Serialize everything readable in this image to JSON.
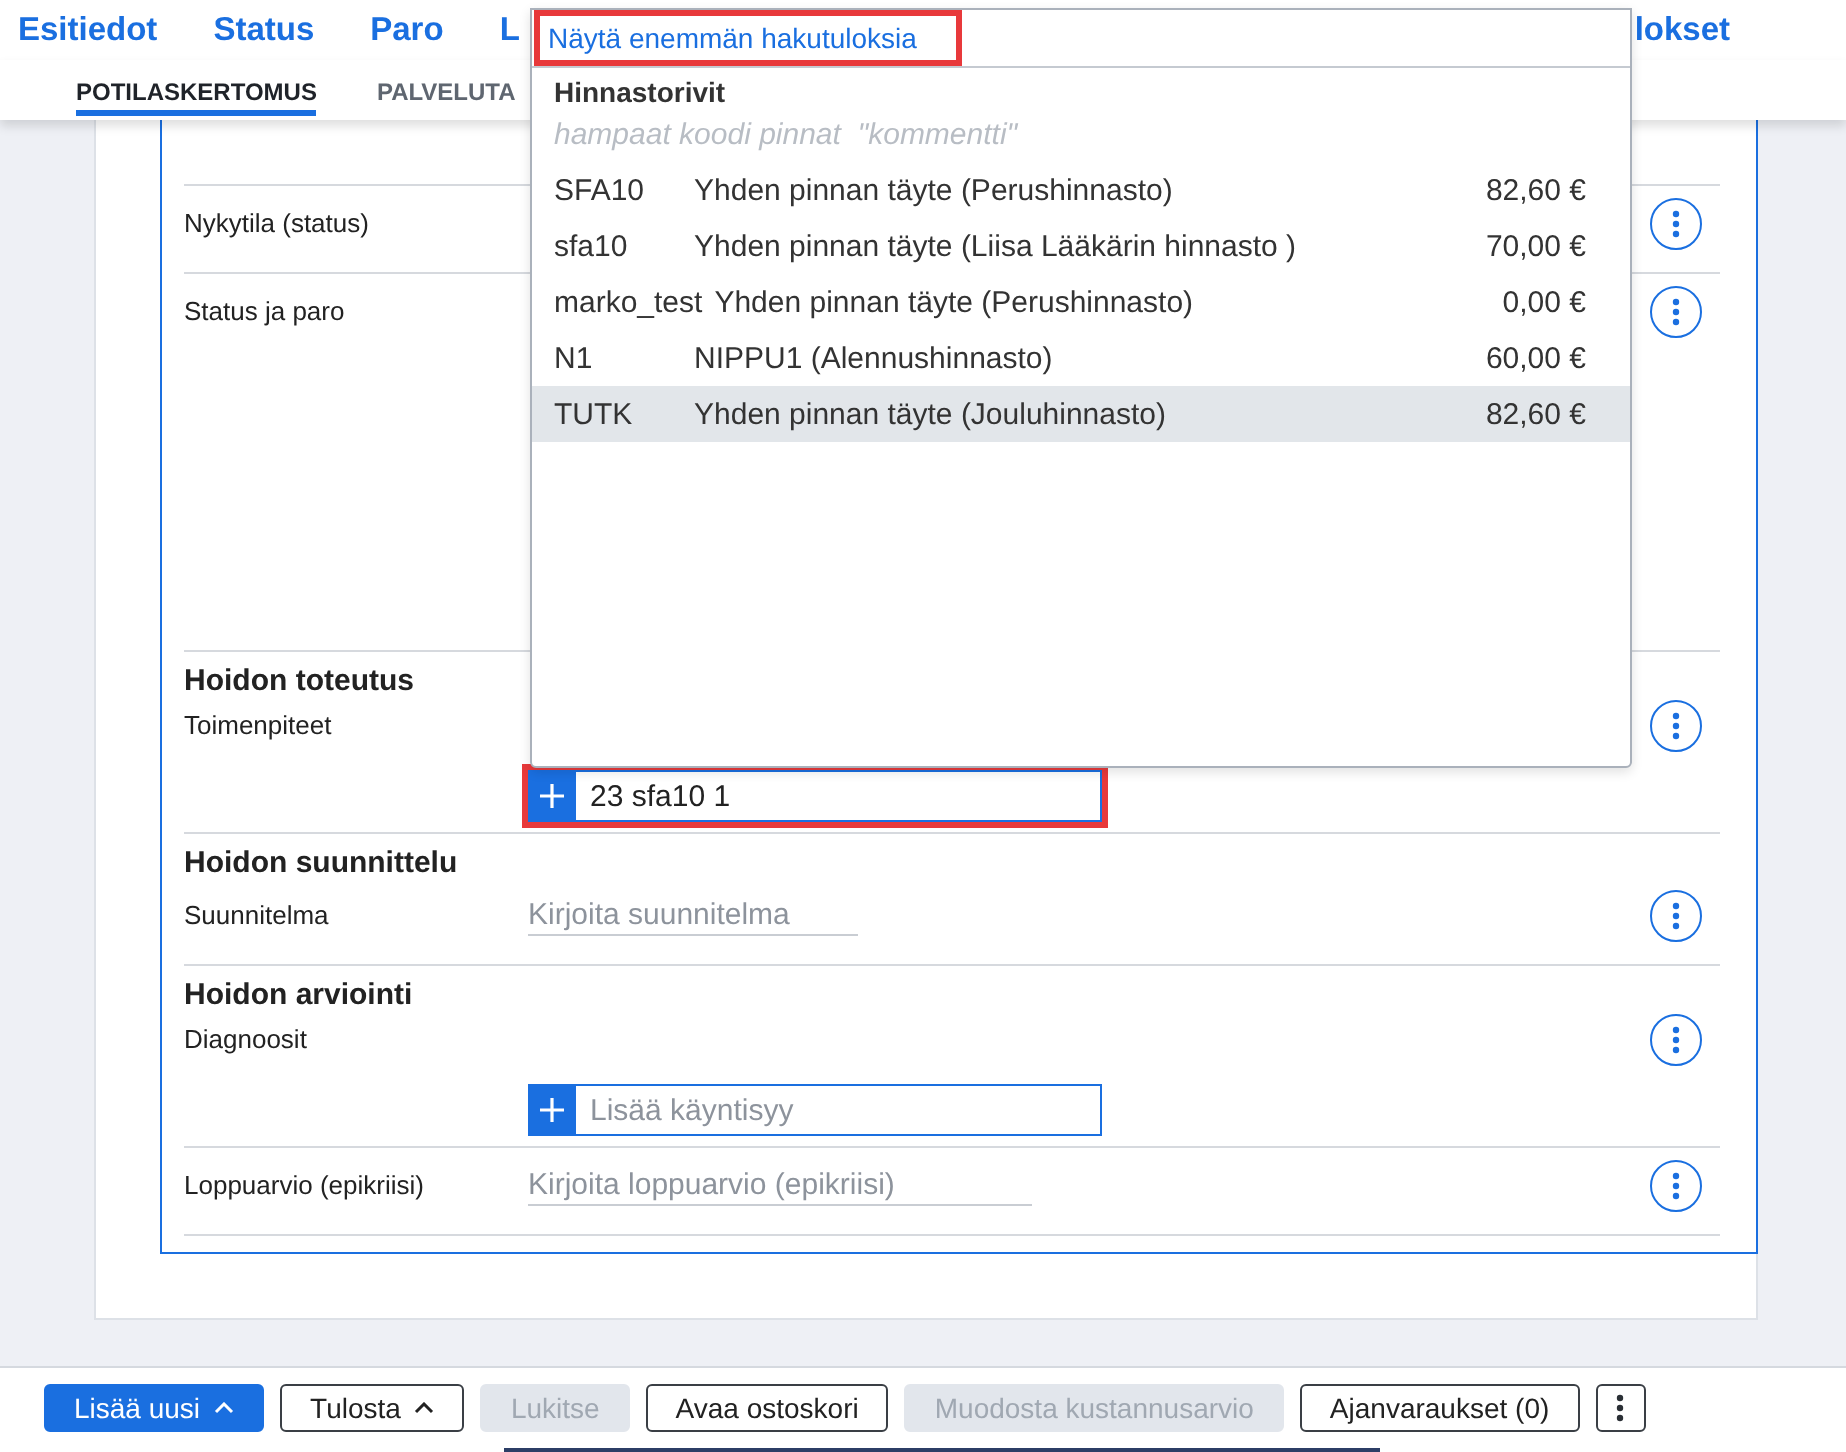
{
  "nav_tabs": [
    {
      "label": "Esitiedot"
    },
    {
      "label": "Status"
    },
    {
      "label": "Paro"
    },
    {
      "label": "L"
    },
    {
      "label": "lokset"
    }
  ],
  "sub_tabs": [
    {
      "label": "POTILASKERTOMUS",
      "selected": true
    },
    {
      "label": "PALVELUTA",
      "selected": false
    }
  ],
  "search_results": {
    "more_link": {
      "label": "Näytä enemmän hakutuloksia",
      "highlighted": true
    },
    "group": "Hinnastorivit",
    "hint": "hampaat koodi pinnat  \"kommentti\"",
    "items": [
      {
        "code": "SFA10",
        "name": "Yhden pinnan täyte (Perushinnasto)",
        "price": "82,60 €",
        "selected": false
      },
      {
        "code": "sfa10",
        "name": "Yhden pinnan täyte (Liisa Lääkärin hinnasto )",
        "price": "70,00 €",
        "selected": false
      },
      {
        "code": "marko_test",
        "name": "Yhden pinnan täyte (Perushinnasto)",
        "price": "0,00 €",
        "selected": false
      },
      {
        "code": "N1",
        "name": "NIPPU1 (Alennushinnasto)",
        "price": "60,00 €",
        "selected": false
      },
      {
        "code": "TUTK",
        "name": "Yhden pinnan täyte (Jouluhinnasto)",
        "price": "82,60 €",
        "selected": true
      }
    ]
  },
  "form_rows": [
    {
      "kind": "empty"
    },
    {
      "kind": "line",
      "label": "Nykytila (status)"
    },
    {
      "kind": "panel",
      "label": "Status ja paro"
    },
    {
      "kind": "add-list",
      "heading": "Hoidon toteutus",
      "label": "Toimenpiteet",
      "field": {
        "value": "23 sfa10 1",
        "highlighted": true
      }
    },
    {
      "kind": "note",
      "heading": "Hoidon suunnittelu",
      "label": "Suunnitelma",
      "field": {
        "placeholder": "Kirjoita suunnitelma"
      }
    },
    {
      "kind": "add-list",
      "heading": "Hoidon arviointi",
      "label": "Diagnoosit",
      "field": {
        "placeholder": "Lisää käyntisyy"
      }
    },
    {
      "kind": "note",
      "label": "Loppuarvio (epikriisi)",
      "field": {
        "placeholder": "Kirjoita loppuarvio (epikriisi)"
      }
    }
  ],
  "toolbar": [
    {
      "kind": "primary",
      "label": "Lisää uusi",
      "menu": true,
      "disabled": false
    },
    {
      "kind": "secondary",
      "label": "Tulosta",
      "menu": true,
      "disabled": false
    },
    {
      "kind": "secondary",
      "label": "Lukitse",
      "disabled": true
    },
    {
      "kind": "secondary",
      "label": "Avaa ostoskori",
      "disabled": false
    },
    {
      "kind": "secondary",
      "label": "Muodosta kustannusarvio",
      "disabled": true
    },
    {
      "kind": "secondary",
      "label": "Ajanvaraukset (0)",
      "disabled": false
    },
    {
      "kind": "more",
      "disabled": false
    }
  ]
}
